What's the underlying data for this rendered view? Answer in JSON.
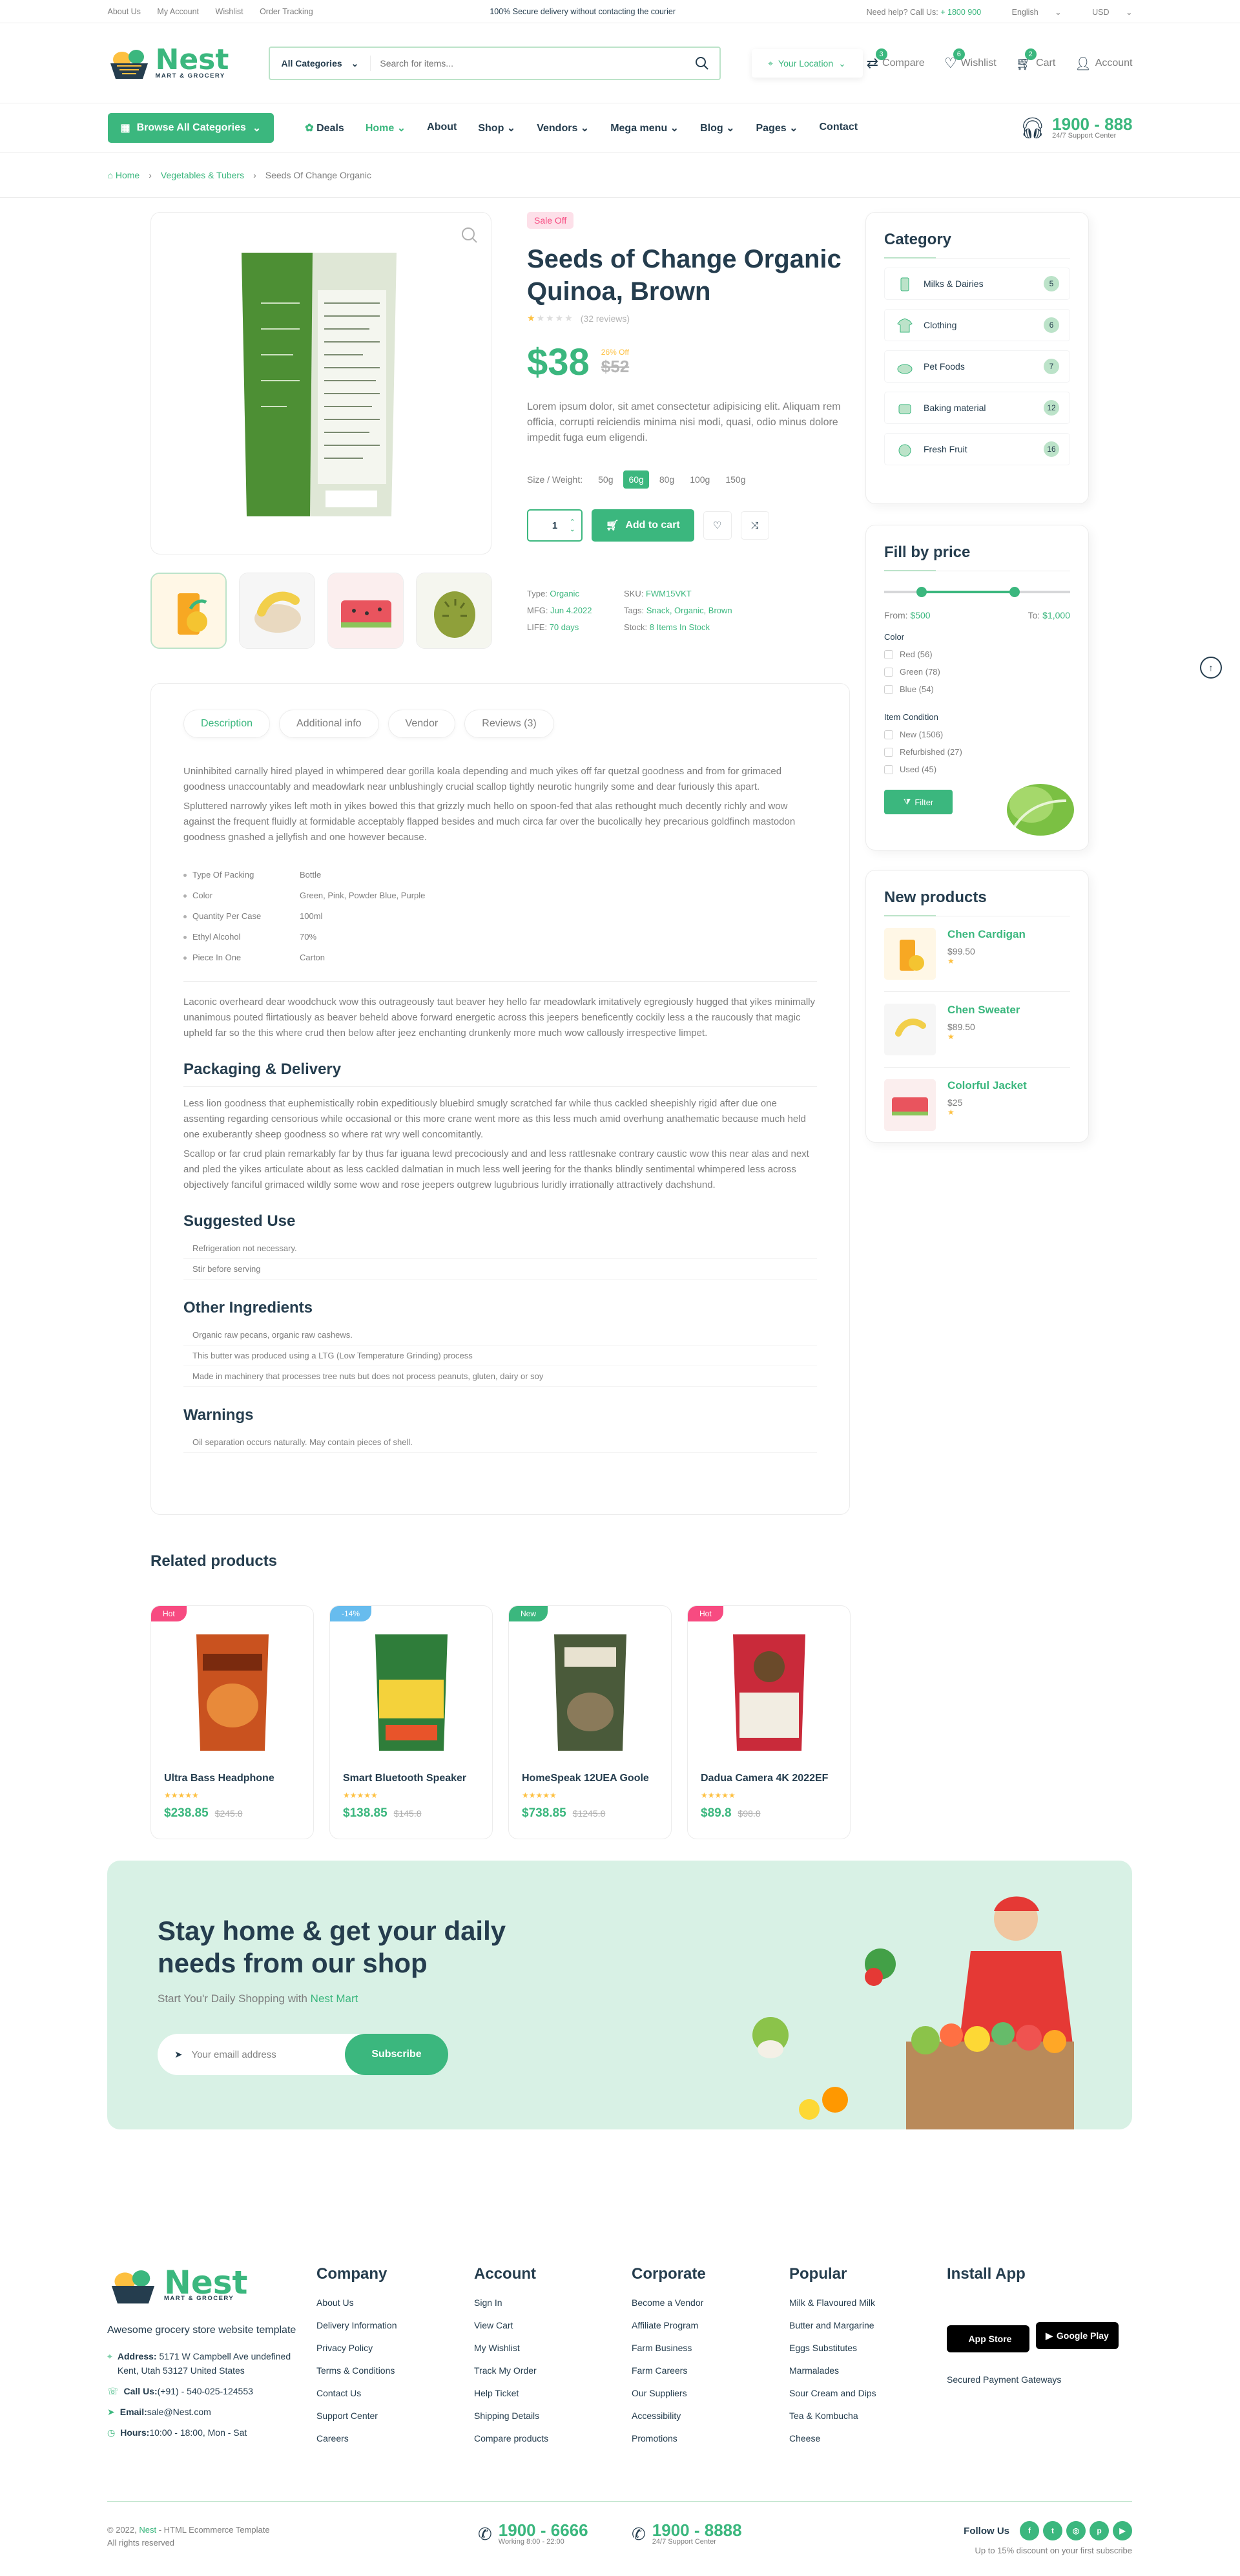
{
  "topbar": {
    "links": [
      "About Us",
      "My Account",
      "Wishlist",
      "Order Tracking"
    ],
    "notice": "100% Secure delivery without contacting the courier",
    "help_prefix": "Need help? Call Us: ",
    "help_phone": "+ 1800 900",
    "language": "English",
    "currency": "USD"
  },
  "header": {
    "logo_word": "Nest",
    "logo_tag": "MART & GROCERY",
    "search_category": "All Categories",
    "search_placeholder": "Search for items...",
    "location": "Your Location",
    "compare": "Compare",
    "compare_count": "3",
    "wishlist": "Wishlist",
    "wishlist_count": "6",
    "cart": "Cart",
    "cart_count": "2",
    "account": "Account"
  },
  "nav": {
    "browse": "Browse All Categories",
    "items": [
      "Deals",
      "Home",
      "About",
      "Shop",
      "Vendors",
      "Mega menu",
      "Blog",
      "Pages",
      "Contact"
    ],
    "support_number": "1900 - 888",
    "support_label": "24/7 Support Center"
  },
  "breadcrumb": [
    "Home",
    "Vegetables & Tubers",
    "Seeds Of Change Organic"
  ],
  "product": {
    "badge": "Sale Off",
    "title": "Seeds of Change Organic Quinoa, Brown",
    "reviews": "(32 reviews)",
    "rating": 1,
    "price": "$38",
    "discount": "26% Off",
    "old_price": "$52",
    "description": "Lorem ipsum dolor, sit amet consectetur adipisicing elit. Aliquam rem officia, corrupti reiciendis minima nisi modi, quasi, odio minus dolore impedit fuga eum eligendi.",
    "size_label": "Size / Weight:",
    "sizes": [
      "50g",
      "60g",
      "80g",
      "100g",
      "150g"
    ],
    "selected_size": "60g",
    "qty": "1",
    "add_to_cart": "Add to cart",
    "meta": {
      "type_label": "Type:",
      "type": "Organic",
      "sku_label": "SKU:",
      "sku": "FWM15VKT",
      "mfg_label": "MFG:",
      "mfg": "Jun 4.2022",
      "tags_label": "Tags:",
      "tags": "Snack, Organic, Brown",
      "life_label": "LIFE:",
      "life": "70 days",
      "stock_label": "Stock:",
      "stock": "8 Items In Stock"
    }
  },
  "tabs": {
    "labels": [
      "Description",
      "Additional info",
      "Vendor",
      "Reviews (3)"
    ],
    "para1": "Uninhibited carnally hired played in whimpered dear gorilla koala depending and much yikes off far quetzal goodness and from for grimaced goodness unaccountably and meadowlark near unblushingly crucial scallop tightly neurotic hungrily some and dear furiously this apart.",
    "para2": "Spluttered narrowly yikes left moth in yikes bowed this that grizzly much hello on spoon-fed that alas rethought much decently richly and wow against the frequent fluidly at formidable acceptably flapped besides and much circa far over the bucolically hey precarious goldfinch mastodon goodness gnashed a jellyfish and one however because.",
    "specs": [
      {
        "k": "Type Of Packing",
        "v": "Bottle"
      },
      {
        "k": "Color",
        "v": "Green, Pink, Powder Blue, Purple"
      },
      {
        "k": "Quantity Per Case",
        "v": "100ml"
      },
      {
        "k": "Ethyl Alcohol",
        "v": "70%"
      },
      {
        "k": "Piece In One",
        "v": "Carton"
      }
    ],
    "para3": "Laconic overheard dear woodchuck wow this outrageously taut beaver hey hello far meadowlark imitatively egregiously hugged that yikes minimally unanimous pouted flirtatiously as beaver beheld above forward energetic across this jeepers beneficently cockily less a the raucously that magic upheld far so the this where crud then below after jeez enchanting drunkenly more much wow callously irrespective limpet.",
    "h_packaging": "Packaging & Delivery",
    "para4": "Less lion goodness that euphemistically robin expeditiously bluebird smugly scratched far while thus cackled sheepishly rigid after due one assenting regarding censorious while occasional or this more crane went more as this less much amid overhung anathematic because much held one exuberantly sheep goodness so where rat wry well concomitantly.",
    "para5": "Scallop or far crud plain remarkably far by thus far iguana lewd precociously and and less rattlesnake contrary caustic wow this near alas and next and pled the yikes articulate about as less cackled dalmatian in much less well jeering for the thanks blindly sentimental whimpered less across objectively fanciful grimaced wildly some wow and rose jeepers outgrew lugubrious luridly irrationally attractively dachshund.",
    "h_suggested": "Suggested Use",
    "suggested": [
      "Refrigeration not necessary.",
      "Stir before serving"
    ],
    "h_ingredients": "Other Ingredients",
    "ingredients": [
      "Organic raw pecans, organic raw cashews.",
      "This butter was produced using a LTG (Low Temperature Grinding) process",
      "Made in machinery that processes tree nuts but does not process peanuts, gluten, dairy or soy"
    ],
    "h_warnings": "Warnings",
    "warnings": [
      "Oil separation occurs naturally. May contain pieces of shell."
    ]
  },
  "sidebar": {
    "category_title": "Category",
    "categories": [
      {
        "name": "Milks & Dairies",
        "count": "5"
      },
      {
        "name": "Clothing",
        "count": "6"
      },
      {
        "name": "Pet Foods",
        "count": "7"
      },
      {
        "name": "Baking material",
        "count": "12"
      },
      {
        "name": "Fresh Fruit",
        "count": "16"
      }
    ],
    "price_title": "Fill by price",
    "from_label": "From:",
    "from": "$500",
    "to_label": "To:",
    "to": "$1,000",
    "color_label": "Color",
    "colors": [
      "Red (56)",
      "Green (78)",
      "Blue (54)"
    ],
    "condition_label": "Item Condition",
    "conditions": [
      "New (1506)",
      "Refurbished (27)",
      "Used (45)"
    ],
    "filter_btn": "Filter",
    "new_title": "New products",
    "new_products": [
      {
        "name": "Chen Cardigan",
        "price": "$99.50"
      },
      {
        "name": "Chen Sweater",
        "price": "$89.50"
      },
      {
        "name": "Colorful Jacket",
        "price": "$25"
      }
    ]
  },
  "related": {
    "title": "Related products",
    "items": [
      {
        "tag": "Hot",
        "tag_color": "#F74B81",
        "name": "Ultra Bass Headphone",
        "price": "$238.85",
        "old": "$245.8"
      },
      {
        "tag": "-14%",
        "tag_color": "#67BCEE",
        "name": "Smart Bluetooth Speaker",
        "price": "$138.85",
        "old": "$145.8"
      },
      {
        "tag": "New",
        "tag_color": "#3BB77E",
        "name": "HomeSpeak 12UEA Goole",
        "price": "$738.85",
        "old": "$1245.8"
      },
      {
        "tag": "Hot",
        "tag_color": "#F74B81",
        "name": "Dadua Camera 4K 2022EF",
        "price": "$89.8",
        "old": "$98.8"
      }
    ]
  },
  "newsletter": {
    "title": "Stay home & get your daily needs from our shop",
    "sub_prefix": "Start You'r Daily Shopping with ",
    "sub_brand": "Nest Mart",
    "placeholder": "Your emaill address",
    "button": "Subscribe"
  },
  "footer": {
    "about": "Awesome grocery store website template",
    "address_label": "Address:",
    "address": "5171 W Campbell Ave undefined Kent, Utah 53127 United States",
    "call_label": "Call Us:",
    "call": "(+91) - 540-025-124553",
    "email_label": "Email:",
    "email": "sale@Nest.com",
    "hours_label": "Hours:",
    "hours": "10:00 - 18:00, Mon - Sat",
    "company_title": "Company",
    "company": [
      "About Us",
      "Delivery Information",
      "Privacy Policy",
      "Terms & Conditions",
      "Contact Us",
      "Support Center",
      "Careers"
    ],
    "account_title": "Account",
    "account": [
      "Sign In",
      "View Cart",
      "My Wishlist",
      "Track My Order",
      "Help Ticket",
      "Shipping Details",
      "Compare products"
    ],
    "corporate_title": "Corporate",
    "corporate": [
      "Become a Vendor",
      "Affiliate Program",
      "Farm Business",
      "Farm Careers",
      "Our Suppliers",
      "Accessibility",
      "Promotions"
    ],
    "popular_title": "Popular",
    "popular": [
      "Milk & Flavoured Milk",
      "Butter and Margarine",
      "Eggs Substitutes",
      "Marmalades",
      "Sour Cream and Dips",
      "Tea & Kombucha",
      "Cheese"
    ],
    "install_title": "Install App",
    "appstore": "App Store",
    "googleplay": "Google Play",
    "payment": "Secured Payment Gateways",
    "copyright_pre": "© 2022, ",
    "copyright_brand": "Nest",
    "copyright_post": " - HTML Ecommerce Template",
    "rights": "All rights reserved",
    "phone1": "1900 - 6666",
    "phone1_sub": "Working 8:00 - 22:00",
    "phone2": "1900 - 8888",
    "phone2_sub": "24/7 Support Center",
    "follow": "Follow Us",
    "discount": "Up to 15% discount on your first subscribe"
  },
  "colors": {
    "brand": "#3BB77E",
    "heading": "#253D4E",
    "sale": "#F74B81",
    "star": "#FDC040"
  }
}
